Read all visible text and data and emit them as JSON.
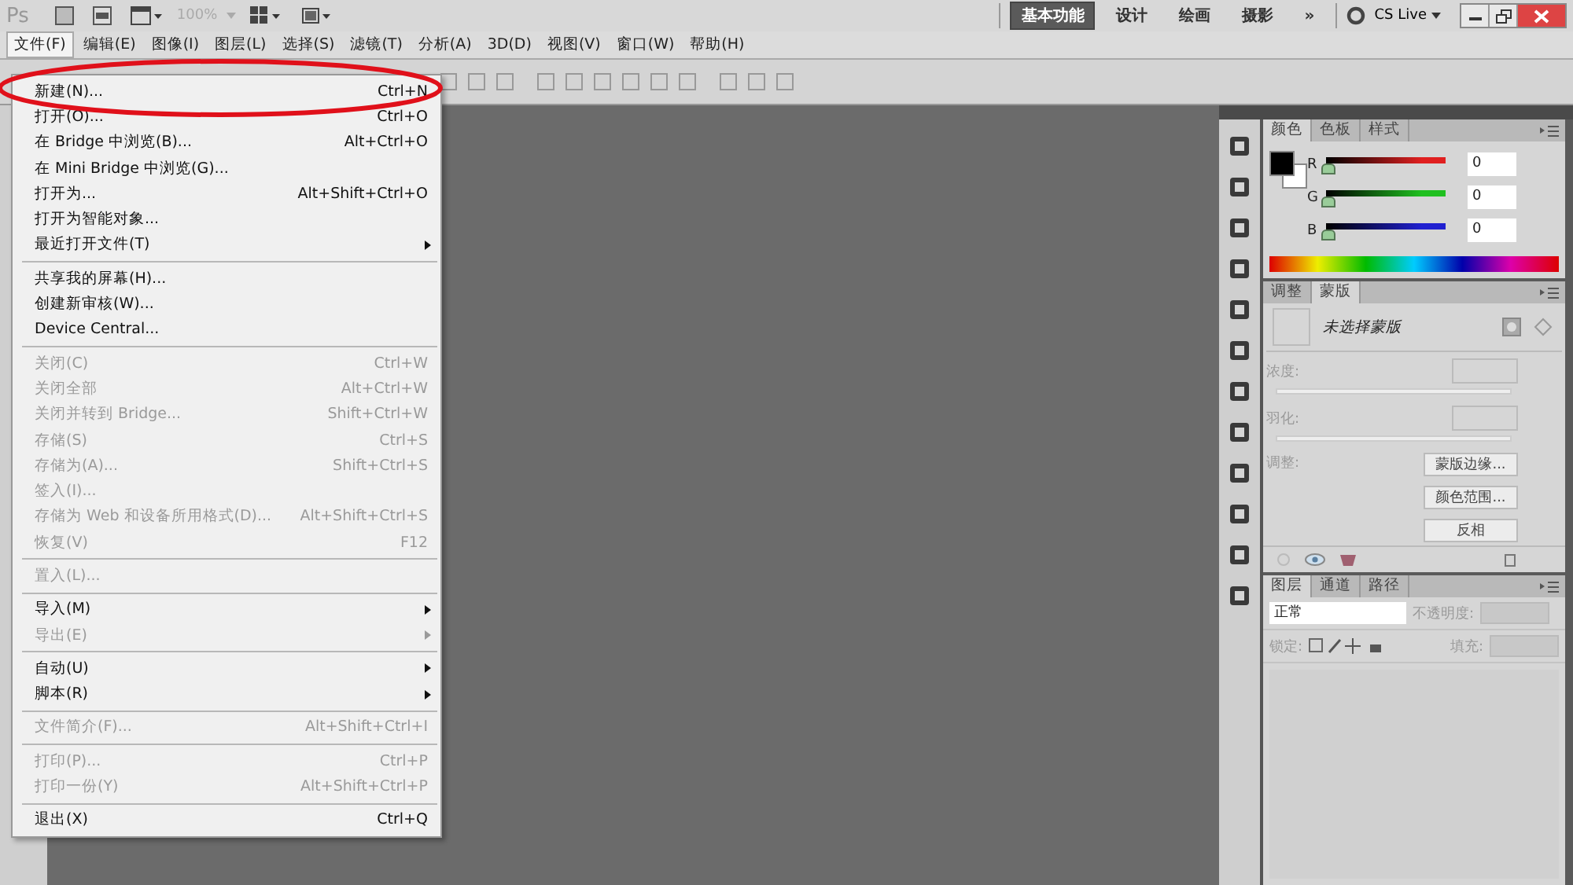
{
  "app_bar": {
    "logo": "Ps",
    "zoom": "100%",
    "workspaces": [
      {
        "label": "基本功能",
        "selected": true
      },
      {
        "label": "设计",
        "selected": false
      },
      {
        "label": "绘画",
        "selected": false
      },
      {
        "label": "摄影",
        "selected": false
      }
    ],
    "overflow": "»",
    "cs_live": "CS Live"
  },
  "menu_bar": [
    {
      "label": "文件(F)",
      "selected": true
    },
    {
      "label": "编辑(E)",
      "selected": false
    },
    {
      "label": "图像(I)",
      "selected": false
    },
    {
      "label": "图层(L)",
      "selected": false
    },
    {
      "label": "选择(S)",
      "selected": false
    },
    {
      "label": "滤镜(T)",
      "selected": false
    },
    {
      "label": "分析(A)",
      "selected": false
    },
    {
      "label": "3D(D)",
      "selected": false
    },
    {
      "label": "视图(V)",
      "selected": false
    },
    {
      "label": "窗口(W)",
      "selected": false
    },
    {
      "label": "帮助(H)",
      "selected": false
    }
  ],
  "file_menu": {
    "groups": [
      [
        {
          "label": "新建(N)...",
          "shortcut": "Ctrl+N",
          "disabled": false,
          "submenu": false
        },
        {
          "label": "打开(O)...",
          "shortcut": "Ctrl+O",
          "disabled": false,
          "submenu": false
        },
        {
          "label": "在 Bridge 中浏览(B)...",
          "shortcut": "Alt+Ctrl+O",
          "disabled": false,
          "submenu": false
        },
        {
          "label": "在 Mini Bridge 中浏览(G)...",
          "disabled": false,
          "submenu": false
        },
        {
          "label": "打开为...",
          "shortcut": "Alt+Shift+Ctrl+O",
          "disabled": false,
          "submenu": false
        },
        {
          "label": "打开为智能对象...",
          "disabled": false,
          "submenu": false
        },
        {
          "label": "最近打开文件(T)",
          "disabled": false,
          "submenu": true
        }
      ],
      [
        {
          "label": "共享我的屏幕(H)...",
          "disabled": false,
          "submenu": false
        },
        {
          "label": "创建新审核(W)...",
          "disabled": false,
          "submenu": false
        },
        {
          "label": "Device Central...",
          "disabled": false,
          "submenu": false
        }
      ],
      [
        {
          "label": "关闭(C)",
          "shortcut": "Ctrl+W",
          "disabled": true,
          "submenu": false
        },
        {
          "label": "关闭全部",
          "shortcut": "Alt+Ctrl+W",
          "disabled": true,
          "submenu": false
        },
        {
          "label": "关闭并转到 Bridge...",
          "shortcut": "Shift+Ctrl+W",
          "disabled": true,
          "submenu": false
        },
        {
          "label": "存储(S)",
          "shortcut": "Ctrl+S",
          "disabled": true,
          "submenu": false
        },
        {
          "label": "存储为(A)...",
          "shortcut": "Shift+Ctrl+S",
          "disabled": true,
          "submenu": false
        },
        {
          "label": "签入(I)...",
          "disabled": true,
          "submenu": false
        },
        {
          "label": "存储为 Web 和设备所用格式(D)...",
          "shortcut": "Alt+Shift+Ctrl+S",
          "disabled": true,
          "submenu": false
        },
        {
          "label": "恢复(V)",
          "shortcut": "F12",
          "disabled": true,
          "submenu": false
        }
      ],
      [
        {
          "label": "置入(L)...",
          "disabled": true,
          "submenu": false
        }
      ],
      [
        {
          "label": "导入(M)",
          "disabled": false,
          "submenu": true
        },
        {
          "label": "导出(E)",
          "disabled": true,
          "submenu": true
        }
      ],
      [
        {
          "label": "自动(U)",
          "disabled": false,
          "submenu": true
        },
        {
          "label": "脚本(R)",
          "disabled": false,
          "submenu": true
        }
      ],
      [
        {
          "label": "文件简介(F)...",
          "shortcut": "Alt+Shift+Ctrl+I",
          "disabled": true,
          "submenu": false
        }
      ],
      [
        {
          "label": "打印(P)...",
          "shortcut": "Ctrl+P",
          "disabled": true,
          "submenu": false
        },
        {
          "label": "打印一份(Y)",
          "shortcut": "Alt+Shift+Ctrl+P",
          "disabled": true,
          "submenu": false
        }
      ],
      [
        {
          "label": "退出(X)",
          "shortcut": "Ctrl+Q",
          "disabled": false,
          "submenu": false
        }
      ]
    ]
  },
  "color_panel": {
    "tabs": [
      {
        "label": "颜色",
        "selected": true
      },
      {
        "label": "色板",
        "selected": false
      },
      {
        "label": "样式",
        "selected": false
      }
    ],
    "channels": [
      {
        "name": "R",
        "value": "0",
        "level": 0,
        "color": "#e02020"
      },
      {
        "name": "G",
        "value": "0",
        "level": 0,
        "color": "#20c020"
      },
      {
        "name": "B",
        "value": "0",
        "level": 0,
        "color": "#2020d0"
      }
    ]
  },
  "masks_panel": {
    "tabs": [
      {
        "label": "调整",
        "selected": false
      },
      {
        "label": "蒙版",
        "selected": true
      }
    ],
    "title": "未选择蒙版",
    "density_label": "浓度:",
    "feather_label": "羽化:",
    "refine_label": "调整:",
    "buttons": [
      "蒙版边缘...",
      "颜色范围...",
      "反相"
    ]
  },
  "layers_panel": {
    "tabs": [
      {
        "label": "图层",
        "selected": true
      },
      {
        "label": "通道",
        "selected": false
      },
      {
        "label": "路径",
        "selected": false
      }
    ],
    "blend_mode": "正常",
    "opacity_label": "不透明度:",
    "lock_label": "锁定:",
    "fill_label": "填充:"
  }
}
